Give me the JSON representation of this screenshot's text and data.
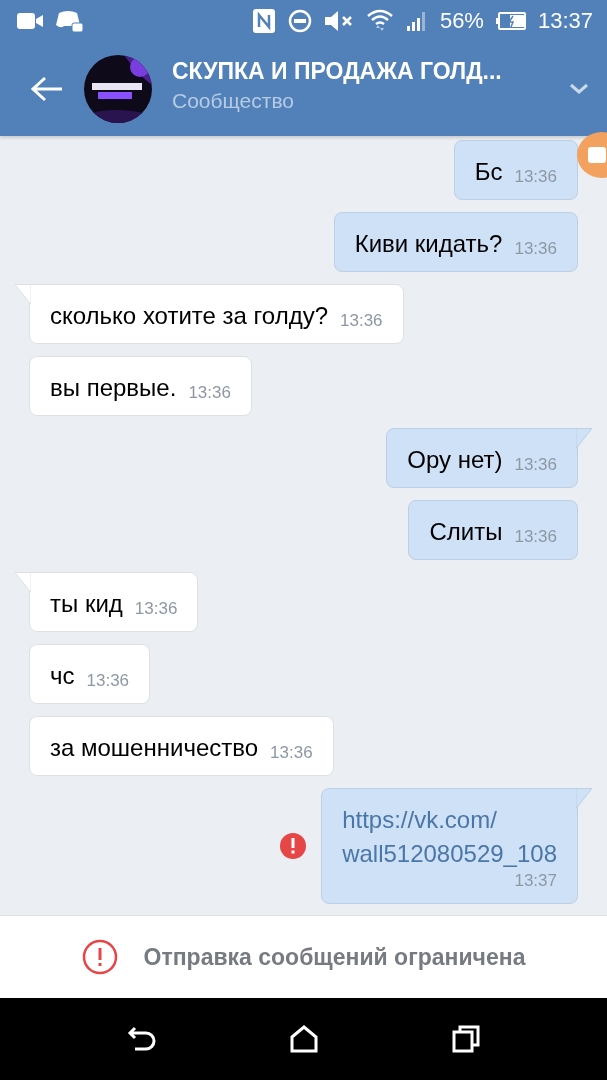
{
  "status_bar": {
    "battery": "56%",
    "time": "13:37"
  },
  "header": {
    "title": "СКУПКА И ПРОДАЖА ГОЛД...",
    "subtitle": "Сообщество"
  },
  "messages": [
    {
      "kind": "outgoing",
      "text": "Бс",
      "time": "13:36",
      "tail": false,
      "failed": false,
      "link": false
    },
    {
      "kind": "outgoing",
      "text": "Киви кидать?",
      "time": "13:36",
      "tail": false,
      "failed": false,
      "link": false
    },
    {
      "kind": "incoming",
      "text": "сколько хотите за голду?",
      "time": "13:36",
      "tail": true,
      "failed": false,
      "link": false
    },
    {
      "kind": "incoming",
      "text": "вы первые.",
      "time": "13:36",
      "tail": false,
      "failed": false,
      "link": false
    },
    {
      "kind": "outgoing",
      "text": "Ору нет)",
      "time": "13:36",
      "tail": true,
      "failed": false,
      "link": false
    },
    {
      "kind": "outgoing",
      "text": "Слиты",
      "time": "13:36",
      "tail": false,
      "failed": false,
      "link": false
    },
    {
      "kind": "incoming",
      "text": "ты кид",
      "time": "13:36",
      "tail": true,
      "failed": false,
      "link": false
    },
    {
      "kind": "incoming",
      "text": "чс",
      "time": "13:36",
      "tail": false,
      "failed": false,
      "link": false
    },
    {
      "kind": "incoming",
      "text": "за мошенничество",
      "time": "13:36",
      "tail": false,
      "failed": false,
      "link": false
    },
    {
      "kind": "outgoing",
      "text": "https://vk.com/\nwall512080529_108",
      "time": "13:37",
      "tail": true,
      "failed": true,
      "link": true
    }
  ],
  "notice": {
    "text": "Отправка сообщений ограничена"
  }
}
